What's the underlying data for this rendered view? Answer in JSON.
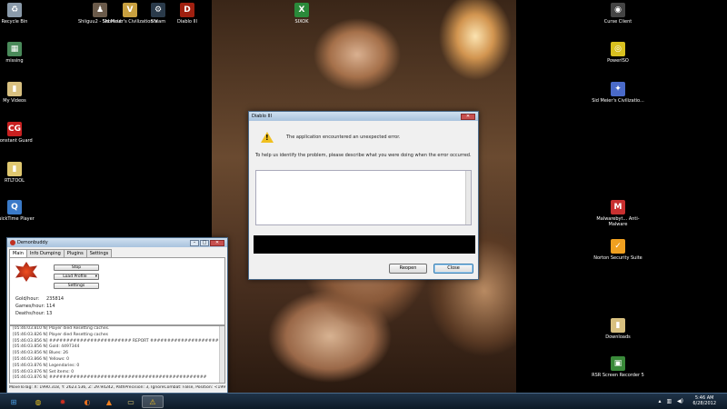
{
  "desktop_icons_left": [
    {
      "label": "Recycle Bin",
      "icon": "recycle-bin-icon",
      "color": "#8a9aaa",
      "glyph": "♻"
    },
    {
      "label": "missing",
      "icon": "generic-file-icon",
      "color": "#4a8a5a",
      "glyph": "▦"
    },
    {
      "label": "My Videos",
      "icon": "folder-icon",
      "color": "#d8c080",
      "glyph": "▮"
    },
    {
      "label": "Constant Guard",
      "icon": "constant-guard-icon",
      "color": "#c82020",
      "glyph": "CG"
    },
    {
      "label": "RTLTOOL",
      "icon": "folder-icon",
      "color": "#e0c870",
      "glyph": "▮"
    },
    {
      "label": "QuickTime Player",
      "icon": "quicktime-icon",
      "color": "#3a7ac8",
      "glyph": "Q"
    }
  ],
  "desktop_icons_top": [
    {
      "label": "Shiiguu2 - Shortcut",
      "icon": "shortcut-icon",
      "color": "#6a5a4a",
      "glyph": "♟"
    },
    {
      "label": "Sid Meier's Civilization V",
      "icon": "civilization-icon",
      "color": "#c8a040",
      "glyph": "V"
    },
    {
      "label": "Steam",
      "icon": "steam-icon",
      "color": "#2a3a4a",
      "glyph": "⚙"
    },
    {
      "label": "Diablo III",
      "icon": "diablo-icon",
      "color": "#a02010",
      "glyph": "D"
    }
  ],
  "desktop_icons_center": [
    {
      "label": "SIXOK",
      "icon": "excel-icon",
      "color": "#2a8a3a",
      "glyph": "X"
    }
  ],
  "desktop_icons_right": [
    {
      "label": "Curse Client",
      "icon": "curse-client-icon",
      "color": "#444",
      "glyph": "◉"
    },
    {
      "label": "PowerISO",
      "icon": "poweriso-icon",
      "color": "#d8c020",
      "glyph": "◎"
    },
    {
      "label": "Sid Meier's Civilizatio...",
      "icon": "civilization-icon",
      "color": "#4a6ac8",
      "glyph": "✦"
    },
    {
      "label": "Malwarebyt... Anti-Malware",
      "icon": "malwarebytes-icon",
      "color": "#c83030",
      "glyph": "M"
    },
    {
      "label": "Norton Security Suite",
      "icon": "norton-icon",
      "color": "#f0a020",
      "glyph": "✓"
    },
    {
      "label": "Downloads",
      "icon": "folder-icon",
      "color": "#d8c080",
      "glyph": "▮"
    },
    {
      "label": "RSR Screen Recorder 5",
      "icon": "screen-recorder-icon",
      "color": "#3a8a3a",
      "glyph": "▣"
    }
  ],
  "error_dialog": {
    "title": "Diablo III",
    "message": "The application encountered an unexpected error.",
    "prompt": "To help us identify the problem, please describe what you were doing when the error occurred.",
    "reopen_label": "Reopen",
    "close_label": "Close"
  },
  "bot_window": {
    "title": "Demonbuddy",
    "tabs": [
      "Main",
      "Info Dumping",
      "Plugins",
      "Settings"
    ],
    "buttons": {
      "stop": "Stop",
      "load_profile": "Load Profile",
      "settings": "Settings"
    },
    "stats": [
      {
        "label": "Gold/hour:",
        "value": "235814"
      },
      {
        "label": "Games/hour:",
        "value": "114"
      },
      {
        "label": "Deaths/hour:",
        "value": "13"
      }
    ],
    "log": [
      "[05:46:03.810 N] Player died Resetting caches.",
      "[05:46:03.826 N] Player died Resetting caches",
      "[05:46:03.856 N] ######################## REPORT ########################",
      "[05:46:03.856 N] Gold: 4497344",
      "[05:46:03.856 N] Blues: 26",
      "[05:46:03.866 N] Yellows: 0",
      "[05:46:03.876 N] Legendaries: 0",
      "[05:46:03.876 N] Set items: 0",
      "[05:46:03.876 N] ##############################################"
    ],
    "status": "MoveToTag: X: 1990.318, Y: 2623.536, Z: 29.94242, PathPrecision: 3, IgnoreCombat: False, Position: <1998.31"
  },
  "taskbar": {
    "items": [
      {
        "name": "start-orb-icon",
        "glyph": "⊞",
        "color": "#4aa0e8"
      },
      {
        "name": "chrome-icon",
        "glyph": "◍",
        "color": "#e8c020"
      },
      {
        "name": "demonbuddy-icon",
        "glyph": "✹",
        "color": "#d03020"
      },
      {
        "name": "firefox-icon",
        "glyph": "◐",
        "color": "#e87020"
      },
      {
        "name": "vlc-icon",
        "glyph": "▲",
        "color": "#f08020"
      },
      {
        "name": "explorer-icon",
        "glyph": "▭",
        "color": "#e0c870"
      },
      {
        "name": "warning-icon",
        "glyph": "⚠",
        "color": "#f0c020"
      }
    ],
    "time": "5:46 AM",
    "date": "6/28/2012"
  }
}
